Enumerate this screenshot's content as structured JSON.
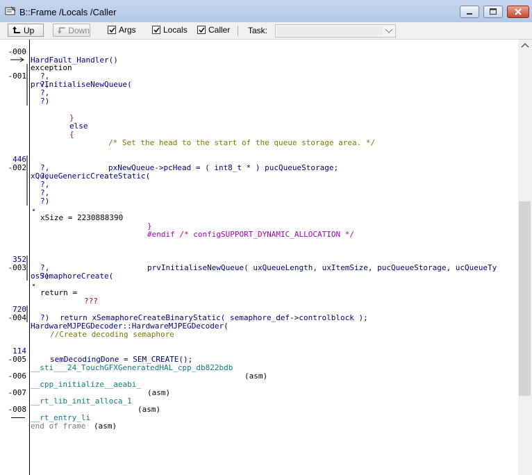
{
  "window": {
    "title": "B::Frame /Locals /Caller"
  },
  "toolbar": {
    "up_label": "Up",
    "down_label": "Down",
    "args_label": "Args",
    "locals_label": "Locals",
    "caller_label": "Caller",
    "args_checked": true,
    "locals_checked": true,
    "caller_checked": true,
    "task_label": "Task:",
    "task_value": ""
  },
  "frame": {
    "l0_gut": "-000",
    "l0": "HardFault_Handler()",
    "l1": "exception",
    "l2_gut": "-001",
    "l2": "prvInitialiseNewQueue(",
    "q": "?,",
    "qend": "?)",
    "brace_close": "}",
    "else_kw": "else",
    "brace_open": "{",
    "c_head": "/* Set the head to the start of the queue storage area. */",
    "l446_gut": "446",
    "l446": "pxNewQueue->pcHead = ( int8_t * ) pucQueueStorage;",
    "l3_gut": "-002",
    "l3": "xQueueGenericCreateStatic(",
    "xsize": "xSize = 2230888390",
    "endif": "#endif /* configSUPPORT_DYNAMIC_ALLOCATION */",
    "l352_gut": "352",
    "l352": "prvInitialiseNewQueue( uxQueueLength, uxItemSize, pucQueueStorage, ucQueueTy",
    "l4_gut": "-003",
    "l4": "osSemaphoreCreate(",
    "ret_label": "return = ",
    "ret_val": "???",
    "l720_gut": "720",
    "l720": "return xSemaphoreCreateBinaryStatic( semaphore_def->controlblock );",
    "l5_gut": "-004",
    "l5": "HardwareMJPEGDecoder::HardwareMJPEGDecoder(",
    "c_dec": "//Create decoding semaphore",
    "l114_gut": "114",
    "l114": "semDecodingDone = SEM_CREATE();",
    "l6_gut": "-005",
    "l6": "__sti___24_TouchGFXGeneratedHAL_cpp_db822bdb",
    "asm": "(asm)",
    "l7_gut": "-006",
    "l7": "__cpp_initialize__aeabi_",
    "l8_gut": "-007",
    "l8": "__rt_lib_init_alloca_1",
    "l9_gut": "-008",
    "l9": "__rt_entry_li",
    "end_label": "end of frame"
  }
}
